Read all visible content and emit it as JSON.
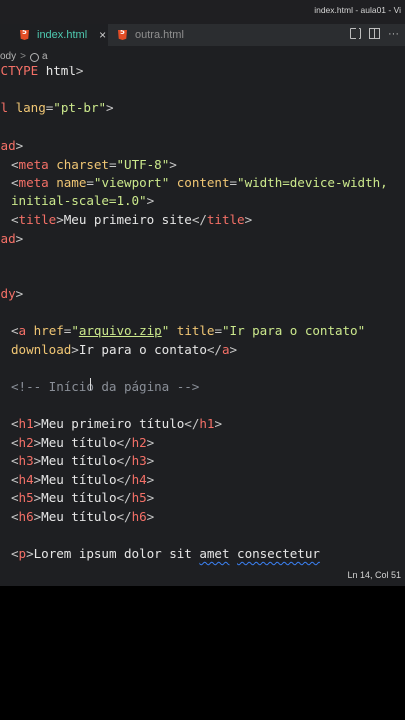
{
  "window": {
    "title": "index.html - aula01 - Vi"
  },
  "tabs": [
    {
      "label": "index.html",
      "active": true,
      "close": "×"
    },
    {
      "label": "outra.html",
      "active": false
    }
  ],
  "breadcrumb": {
    "item1": "ody",
    "separator": ">",
    "item2": "a"
  },
  "status": {
    "cursor_position": "Ln 14, Col 51"
  },
  "code": {
    "l1": {
      "a": "OCTYPE",
      "b": " html",
      "c": ">"
    },
    "l2": {
      "a": "ml",
      "b": " lang",
      "c": "=",
      "d": "\"pt-br\"",
      "e": ">"
    },
    "l3": {
      "a": "ead",
      "b": ">"
    },
    "l4": {
      "lt": "<",
      "tag": "meta",
      "attr": " charset",
      "eq": "=",
      "val": "\"UTF-8\"",
      "gt": ">"
    },
    "l5": {
      "lt": "<",
      "tag": "meta",
      "attr1": " name",
      "eq1": "=",
      "val1": "\"viewport\"",
      "attr2": " content",
      "eq2": "=",
      "val2": "\"width=device-width,",
      "cont": "initial-scale=1.0\"",
      "gt": ">"
    },
    "l6": {
      "lt": "<",
      "tag": "title",
      "gt": ">",
      "text": "Meu primeiro site",
      "lt2": "</",
      "tag2": "title",
      "gt2": ">"
    },
    "l7": {
      "a": "ead",
      "b": ">"
    },
    "l8": {
      "a": "ody",
      "b": ">"
    },
    "l9": {
      "lt": "<",
      "tag": "a",
      "attr1": " href",
      "eq1": "=",
      "q1": "\"",
      "link": "arquivo.zip",
      "q2": "\"",
      "attr2": " title",
      "eq2": "=",
      "val2": "\"Ir para o contato\"",
      "attr3": "download",
      "gt": ">",
      "text": "Ir para o contato",
      "lt2": "</",
      "tag2": "a",
      "gt2": ">"
    },
    "l10": {
      "comment": "<!-- Início da página -->"
    },
    "headings": [
      {
        "tag": "h1",
        "text": "Meu primeiro título"
      },
      {
        "tag": "h2",
        "text": "Meu título"
      },
      {
        "tag": "h3",
        "text": "Meu título"
      },
      {
        "tag": "h4",
        "text": "Meu título"
      },
      {
        "tag": "h5",
        "text": "Meu título"
      },
      {
        "tag": "h6",
        "text": "Meu título"
      }
    ],
    "p": {
      "lt": "<",
      "tag": "p",
      "gt": ">",
      "text1": "Lorem ipsum dolor sit ",
      "w1": "amet",
      "sp": " ",
      "w2": "consectetur"
    }
  },
  "colors": {
    "tag": "#f47067",
    "attribute": "#f0c674",
    "string": "#cbe88c",
    "comment": "#8a8f98",
    "active_tab_text": "#4ec9b0",
    "html_icon": "#e44d26"
  }
}
